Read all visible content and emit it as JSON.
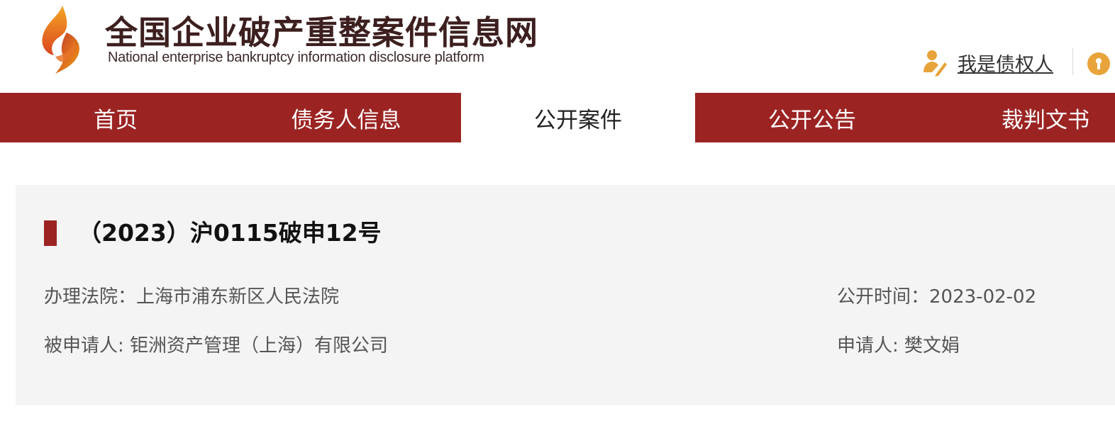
{
  "header": {
    "site_title_cn": "全国企业破产重整案件信息网",
    "site_title_en": "National enterprise bankruptcy  information disclosure platform",
    "creditor_link": "我是债权人"
  },
  "nav": {
    "items": [
      {
        "label": "首页"
      },
      {
        "label": "债务人信息"
      },
      {
        "label": "公开案件"
      },
      {
        "label": "公开公告"
      },
      {
        "label": "裁判文书"
      }
    ],
    "active_index": 2
  },
  "case": {
    "number": "（2023）沪0115破申12号",
    "court_label": "办理法院：",
    "court_value": "上海市浦东新区人民法院",
    "publish_label": "公开时间：",
    "publish_value": "2023-02-02",
    "respondent_label": "被申请人: ",
    "respondent_value": "钜洲资产管理（上海）有限公司",
    "applicant_label": "申请人: ",
    "applicant_value": "樊文娟"
  },
  "colors": {
    "brand_red": "#9b2423",
    "card_bg": "#f4f4f4",
    "logo_orange": "#e8742a"
  },
  "icons": {
    "logo": "flame-logo-icon",
    "creditor": "person-pen-icon",
    "lock": "lock-icon"
  }
}
